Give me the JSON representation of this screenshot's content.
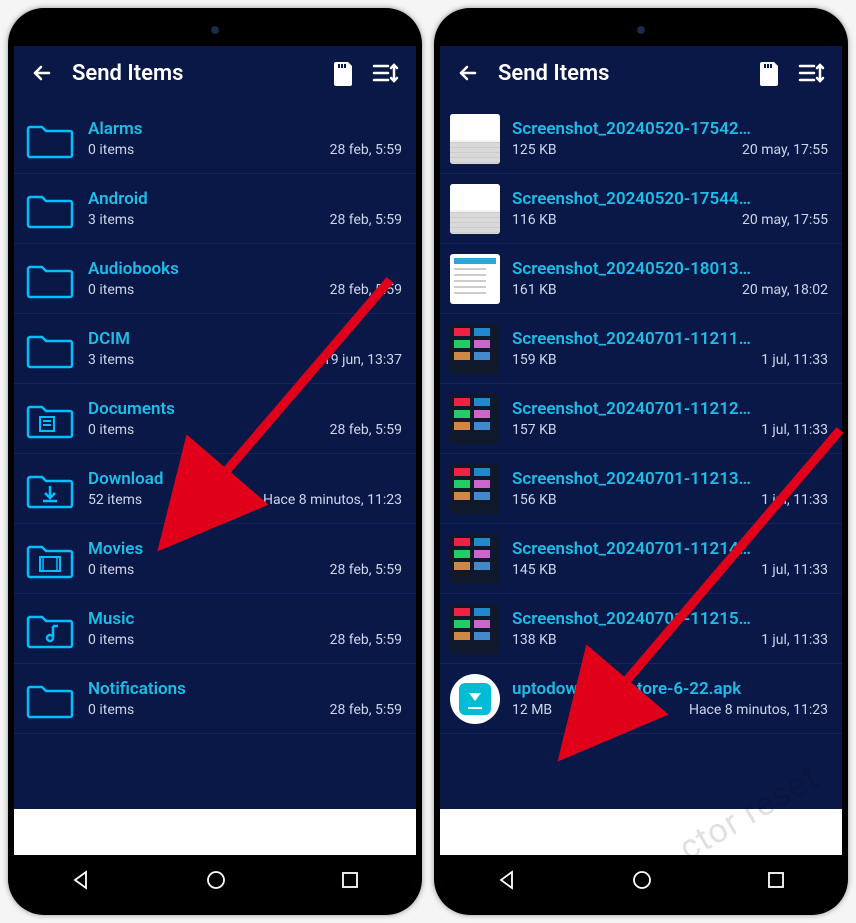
{
  "colors": {
    "accent": "#1fbce8",
    "folder": "#00bfff",
    "bg": "#0a1848"
  },
  "left": {
    "title": "Send Items",
    "items": [
      {
        "icon": "folder",
        "name": "Alarms",
        "sub": "0 items",
        "date": "28 feb, 5:59"
      },
      {
        "icon": "folder",
        "name": "Android",
        "sub": "3 items",
        "date": "28 feb, 5:59"
      },
      {
        "icon": "folder",
        "name": "Audiobooks",
        "sub": "0 items",
        "date": "28 feb, 5:59"
      },
      {
        "icon": "folder",
        "name": "DCIM",
        "sub": "3 items",
        "date": "19 jun, 13:37"
      },
      {
        "icon": "doc-folder",
        "name": "Documents",
        "sub": "0 items",
        "date": "28 feb, 5:59"
      },
      {
        "icon": "dl-folder",
        "name": "Download",
        "sub": "52 items",
        "date": "Hace 8 minutos, 11:23"
      },
      {
        "icon": "mov-folder",
        "name": "Movies",
        "sub": "0 items",
        "date": "28 feb, 5:59"
      },
      {
        "icon": "mus-folder",
        "name": "Music",
        "sub": "0 items",
        "date": "28 feb, 5:59"
      },
      {
        "icon": "folder",
        "name": "Notifications",
        "sub": "0 items",
        "date": "28 feb, 5:59"
      }
    ]
  },
  "right": {
    "title": "Send Items",
    "items": [
      {
        "thumb": "light",
        "name": "Screenshot_20240520-17542…",
        "sub": "125 KB",
        "date": "20 may, 17:55"
      },
      {
        "thumb": "light",
        "name": "Screenshot_20240520-17544…",
        "sub": "116 KB",
        "date": "20 may, 17:55"
      },
      {
        "thumb": "doc",
        "name": "Screenshot_20240520-18013…",
        "sub": "161 KB",
        "date": "20 may, 18:02"
      },
      {
        "thumb": "dark",
        "name": "Screenshot_20240701-11211…",
        "sub": "159 KB",
        "date": "1 jul, 11:33"
      },
      {
        "thumb": "dark",
        "name": "Screenshot_20240701-11212…",
        "sub": "157 KB",
        "date": "1 jul, 11:33"
      },
      {
        "thumb": "dark",
        "name": "Screenshot_20240701-11213…",
        "sub": "156 KB",
        "date": "1 jul, 11:33"
      },
      {
        "thumb": "dark",
        "name": "Screenshot_20240701-11214…",
        "sub": "145 KB",
        "date": "1 jul, 11:33"
      },
      {
        "thumb": "dark",
        "name": "Screenshot_20240701-11215…",
        "sub": "138 KB",
        "date": "1 jul, 11:33"
      },
      {
        "thumb": "apk",
        "name": "uptodown-app-store-6-22.apk",
        "sub": "12 MB",
        "date": "Hace 8 minutos, 11:23"
      }
    ]
  }
}
